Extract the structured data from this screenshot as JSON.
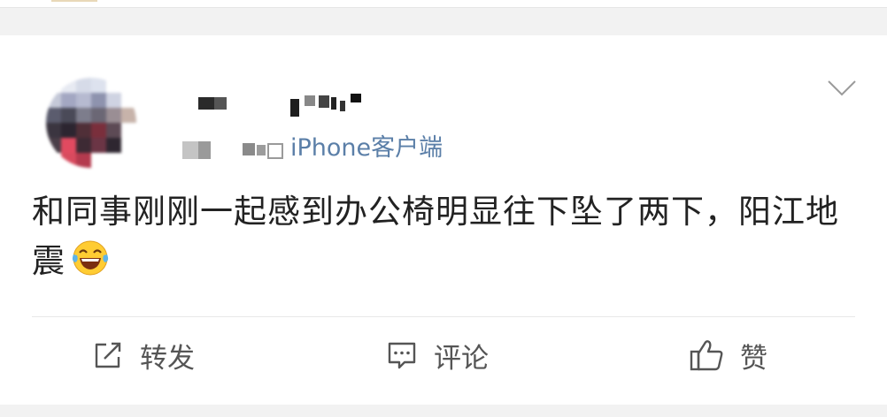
{
  "post": {
    "source": "iPhone客户端",
    "text": "和同事刚刚一起感到办公椅明显往下坠了两下，阳江地震"
  },
  "icons": {
    "emoji": "laughing-with-tears-emoji",
    "menu": "chevron-down-icon",
    "repost": "repost-icon",
    "comment": "comment-icon",
    "like": "thumbs-up-icon"
  },
  "actions": {
    "repost_label": "转发",
    "comment_label": "评论",
    "like_label": "赞"
  },
  "colors": {
    "source_link": "#5b7fa8",
    "text": "#222222",
    "action_text": "#555555",
    "background": "#f2f2f2"
  }
}
